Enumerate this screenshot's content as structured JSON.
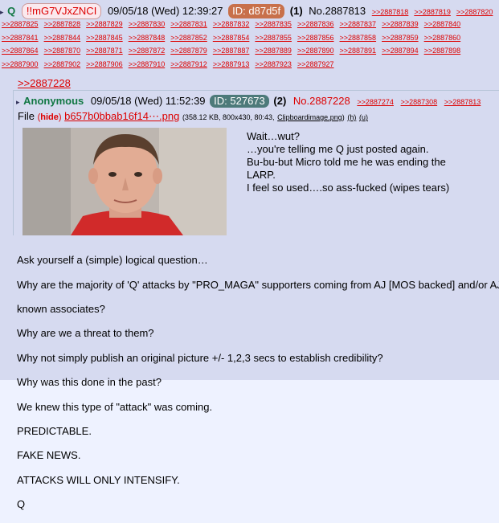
{
  "colors": {
    "bg": "#d6daf0",
    "name": "#117743",
    "link": "#dd0000",
    "id_outer": "#c8704a",
    "id_inner": "#4d7a7a"
  },
  "post": {
    "arrow": "▸",
    "name": "Q",
    "trip": "!!mG7VJxZNCI",
    "date": "09/05/18 (Wed) 12:39:27",
    "id_label": "ID: d87d5f",
    "count": "(1)",
    "number": "No.2887813",
    "backlink_rows": [
      [
        ">>2887818",
        ">>2887819",
        ">>2887820"
      ],
      [
        ">>2887825",
        ">>2887828",
        ">>2887829",
        ">>2887830",
        ">>2887831",
        ">>2887832",
        ">>2887835",
        ">>2887836",
        ">>2887837",
        ">>2887839",
        ">>2887840"
      ],
      [
        ">>2887841",
        ">>2887844",
        ">>2887845",
        ">>2887848",
        ">>2887852",
        ">>2887854",
        ">>2887855",
        ">>2887856",
        ">>2887858",
        ">>2887859",
        ">>2887860"
      ],
      [
        ">>2887864",
        ">>2887870",
        ">>2887871",
        ">>2887872",
        ">>2887879",
        ">>2887887",
        ">>2887889",
        ">>2887890",
        ">>2887891",
        ">>2887894",
        ">>2887898"
      ],
      [
        ">>2887900",
        ">>2887902",
        ">>2887906",
        ">>2887910",
        ">>2887912",
        ">>2887913",
        ">>2887923",
        ">>2887927"
      ]
    ],
    "quote_link": ">>2887228",
    "quoted": {
      "arrow": "▸",
      "name": "Anonymous",
      "date": "09/05/18 (Wed) 11:52:39",
      "id_label": "ID: 527673",
      "count": "(2)",
      "number": "No.2887228",
      "backlinks": [
        ">>2887274",
        ">>2887308",
        ">>2887813"
      ],
      "file_label": "File",
      "hide_label": "hide",
      "file_name": "b657b0bbab16f14⋯.png",
      "file_meta": "(358.12 KB, 800x430, 80:43,",
      "file_meta_link": "Clipboardimage.png",
      "h_link": "(h)",
      "u_link": "(u)",
      "text_lines": [
        "Wait…wut?",
        "…you're telling me Q just posted again.",
        "Bu-bu-but Micro told me he was ending the",
        "LARP.",
        "I feel so used….so ass-fucked (wipes tears)"
      ]
    },
    "body_lines": [
      "Ask yourself a (simple) logical question…",
      "Why are the majority of 'Q' attacks by \"PRO_MAGA\" supporters coming from AJ [MOS backed] and/or AJ",
      "known associates?",
      "Why are we a threat to them?",
      "Why not simply publish an original picture +/- 1,2,3 secs to establish credibility?",
      "Why was this done in the past?",
      "We knew this type of \"attack\" was coming.",
      "PREDICTABLE.",
      "FAKE NEWS.",
      "ATTACKS WILL ONLY INTENSIFY.",
      "Q"
    ]
  }
}
